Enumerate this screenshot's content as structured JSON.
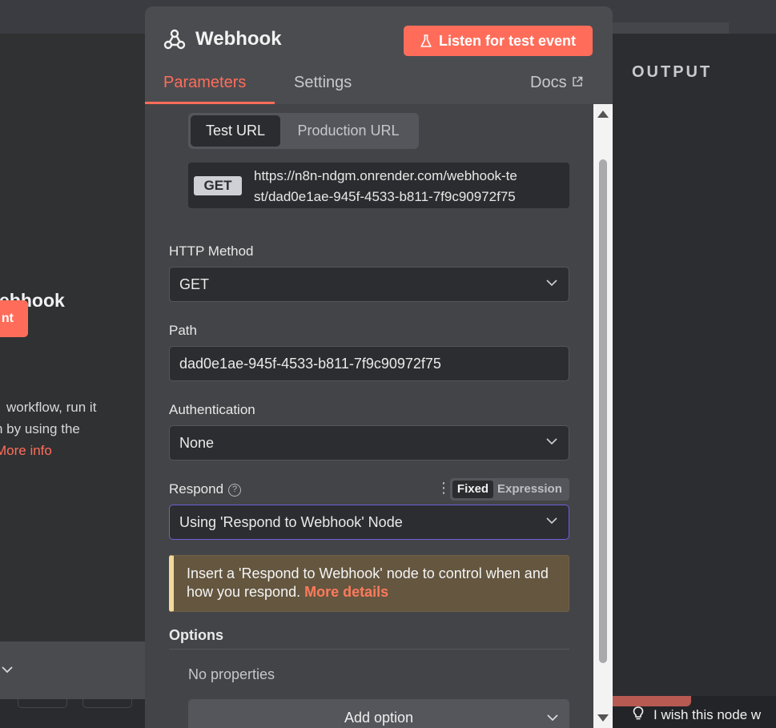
{
  "background": {
    "left_title": "ebhook",
    "left_button_label": "nt",
    "left_desc": [
      "workflow, run it",
      "n by using the",
      "More info"
    ],
    "output_label": "OUTPUT",
    "feedback_text": "I wish this node w"
  },
  "panel": {
    "title": "Webhook",
    "listen_button": "Listen for test event",
    "tabs": [
      {
        "label": "Parameters",
        "active": true
      },
      {
        "label": "Settings",
        "active": false
      }
    ],
    "docs_label": "Docs"
  },
  "url_toggle": {
    "test": "Test URL",
    "production": "Production URL",
    "selected": "Test URL"
  },
  "webhook_url": {
    "method": "GET",
    "lines": [
      "https://n8n-ndgm.onrender.com/webhook-te",
      "st/dad0e1ae-945f-4533-b811-7f9c90972f75"
    ]
  },
  "fields": {
    "http_method": {
      "label": "HTTP Method",
      "value": "GET"
    },
    "path": {
      "label": "Path",
      "value": "dad0e1ae-945f-4533-b811-7f9c90972f75"
    },
    "authentication": {
      "label": "Authentication",
      "value": "None"
    },
    "respond": {
      "label": "Respond",
      "value": "Using 'Respond to Webhook' Node",
      "mode_fixed": "Fixed",
      "mode_expression": "Expression"
    }
  },
  "notice": {
    "text": "Insert a 'Respond to Webhook' node to control when and how you respond. ",
    "link": "More details"
  },
  "options": {
    "label": "Options",
    "empty_text": "No properties",
    "add_button": "Add option"
  },
  "colors": {
    "accent": "#ff6d5a",
    "panel_bg": "#434447",
    "field_bg": "#2c2d30",
    "focus_border": "#6e5fd9",
    "notice_bg": "#64563f",
    "notice_border": "#f4d89c"
  }
}
